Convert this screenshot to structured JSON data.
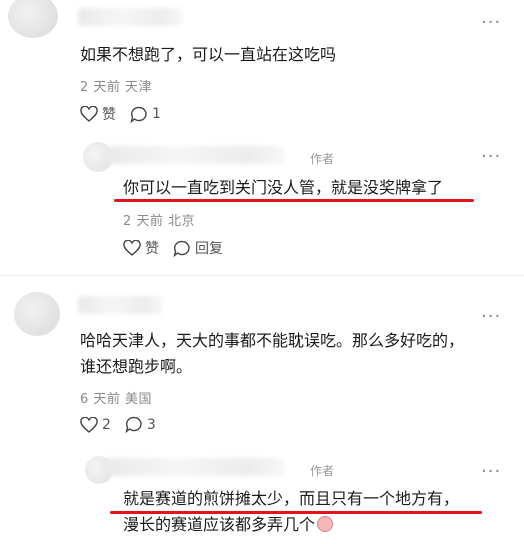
{
  "comments": [
    {
      "text": "如果不想跑了，可以一直站在这吃吗",
      "meta": "2 天前  天津",
      "like_label": "赞",
      "reply_count": "1",
      "reply": {
        "author_tag": "作者",
        "text": "你可以一直吃到关门没人管，就是没奖牌拿了",
        "meta": "2 天前  北京",
        "like_label": "赞",
        "reply_label": "回复"
      }
    },
    {
      "text_line1": "哈哈天津人，天大的事都不能耽误吃。那么多好吃的，",
      "text_line2": "谁还想跑步啊。",
      "meta": "6 天前  美国",
      "like_count": "2",
      "reply_count": "3",
      "reply": {
        "author_tag": "作者",
        "text_line1": "就是赛道的煎饼摊太少，而且只有一个地方有，",
        "text_line2": "漫长的赛道应该都多弄几个"
      }
    }
  ],
  "more_label": "···"
}
